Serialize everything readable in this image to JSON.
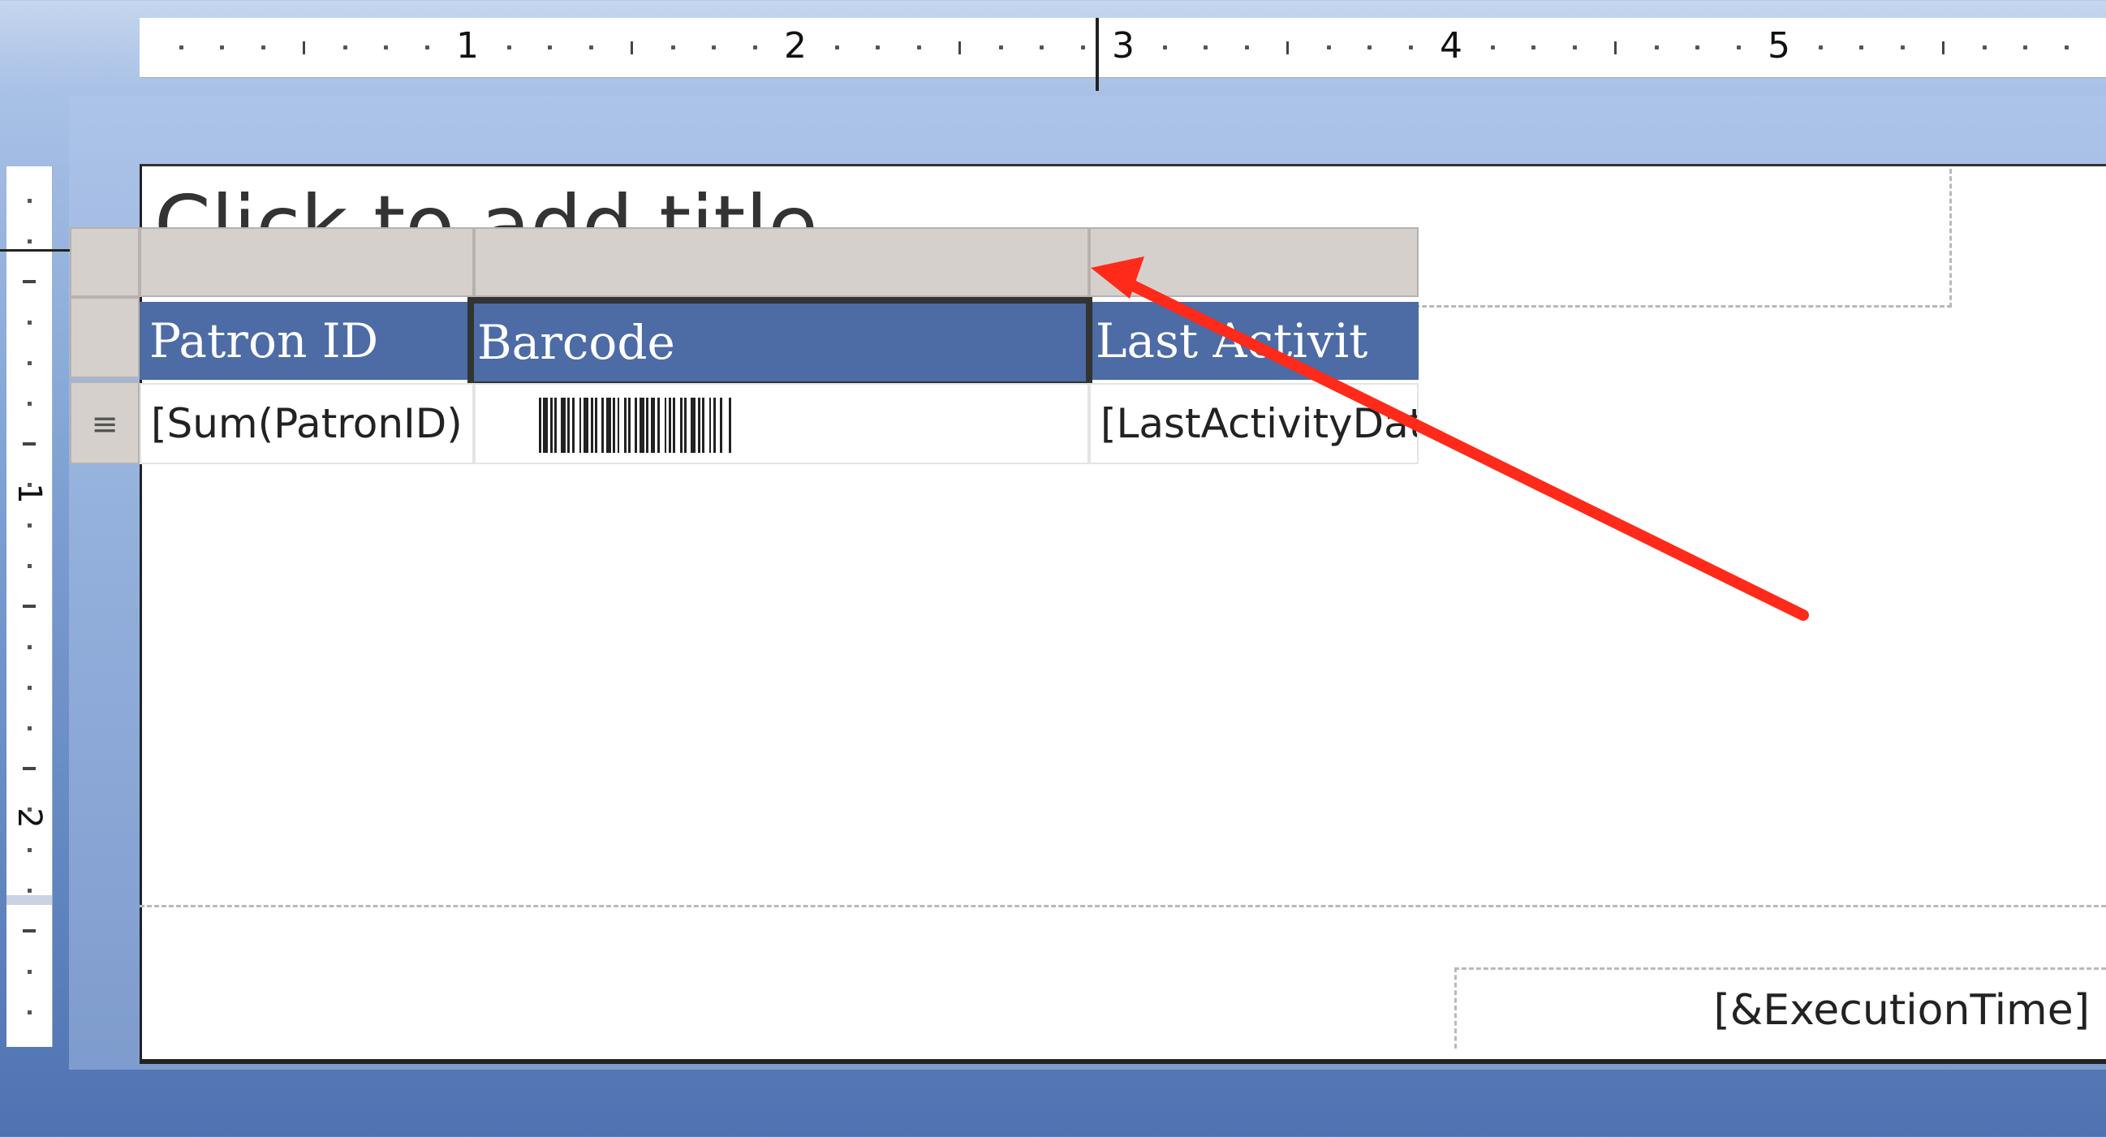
{
  "ruler": {
    "numbers": [
      "1",
      "2",
      "3",
      "4",
      "5"
    ]
  },
  "vruler": {
    "numbers": [
      "1",
      "2"
    ]
  },
  "report": {
    "title_placeholder": "Click to add title",
    "columns": [
      {
        "header": "Patron ID",
        "value": "[Sum(PatronID)"
      },
      {
        "header": "Barcode",
        "value": ""
      },
      {
        "header": "Last Activit",
        "value": "[LastActivityDate"
      }
    ],
    "row_handle_icon": "≡",
    "footer_expression": "[&ExecutionTime]"
  },
  "colors": {
    "header_fill": "#4d6ba5",
    "annotation_arrow": "#ff2a1a"
  },
  "icons": {
    "row_handle": "row-handle-icon",
    "barcode": "barcode-icon"
  }
}
